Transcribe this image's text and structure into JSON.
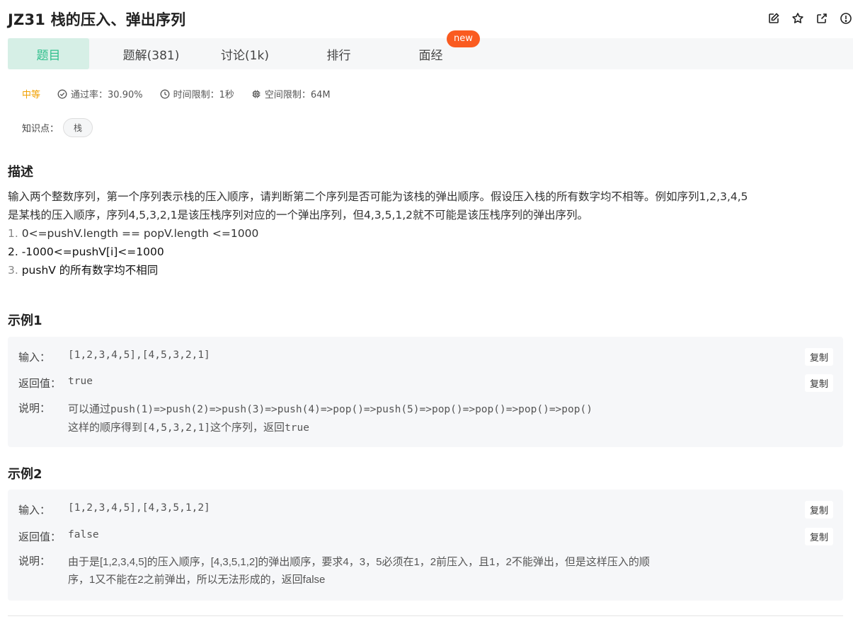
{
  "problem": {
    "title": "JZ31  栈的压入、弹出序列",
    "difficulty": "中等",
    "pass_rate": "通过率：30.90%",
    "time_limit": "时间限制：1秒",
    "space_limit": "空间限制：64M",
    "knowledge_label": "知识点：",
    "tag": "栈"
  },
  "tabs": [
    {
      "label": "题目",
      "active": true
    },
    {
      "label": "题解(381)"
    },
    {
      "label": "讨论(1k)"
    },
    {
      "label": "排行"
    },
    {
      "label": "面经"
    }
  ],
  "badge": "new",
  "icons": [
    "edit-icon",
    "star-icon",
    "external-link-icon",
    "report-icon"
  ],
  "description": {
    "heading": "描述",
    "line1": "输入两个整数序列，第一个序列表示栈的压入顺序，请判断第二个序列是否可能为该栈的弹出顺序。假设压入栈的所有数字均不相等。例如序列1,2,3,4,5",
    "line2": "是某栈的压入顺序，序列4,5,3,2,1是该压栈序列对应的一个弹出序列，但4,3,5,1,2就不可能是该压栈序列的弹出序列。",
    "items": [
      {
        "num": "1. ",
        "text": "0<=pushV.length == popV.length <=1000"
      },
      {
        "num": "2. ",
        "text": "-1000<=pushV[i]<=1000"
      },
      {
        "num": "3. ",
        "text": "pushV 的所有数字均不相同"
      }
    ]
  },
  "examples": [
    {
      "heading": "示例1",
      "input_label": "输入：",
      "input": "[1,2,3,4,5],[4,5,3,2,1]",
      "output_label": "返回值：",
      "output": "true",
      "explain_label": "说明：",
      "explain_a": "可以通过",
      "explain_b": "push(1)=>push(2)=>push(3)=>push(4)=>pop()=>push(5)=>pop()=>pop()=>pop()=>pop()",
      "explain_c": "这样的顺序得到",
      "explain_d": "[4,5,3,2,1]",
      "explain_e": "这个序列，返回",
      "explain_f": "true",
      "copy": "复制"
    },
    {
      "heading": "示例2",
      "input_label": "输入：",
      "input": "[1,2,3,4,5],[4,3,5,1,2]",
      "output_label": "返回值：",
      "output": "false",
      "explain_label": "说明：",
      "explain_line1": "由于是[1,2,3,4,5]的压入顺序，[4,3,5,1,2]的弹出顺序，要求4，3，5必须在1，2前压入，且1，2不能弹出，但是这样压入的顺",
      "explain_line2": "序，1又不能在2之前弹出，所以无法形成的，返回false",
      "copy": "复制"
    }
  ],
  "colors": {
    "accent": "#2fbf8c",
    "active_tab_bg": "#d6efe6",
    "difficulty": "#f0a000",
    "badge": "#fa5b20"
  }
}
